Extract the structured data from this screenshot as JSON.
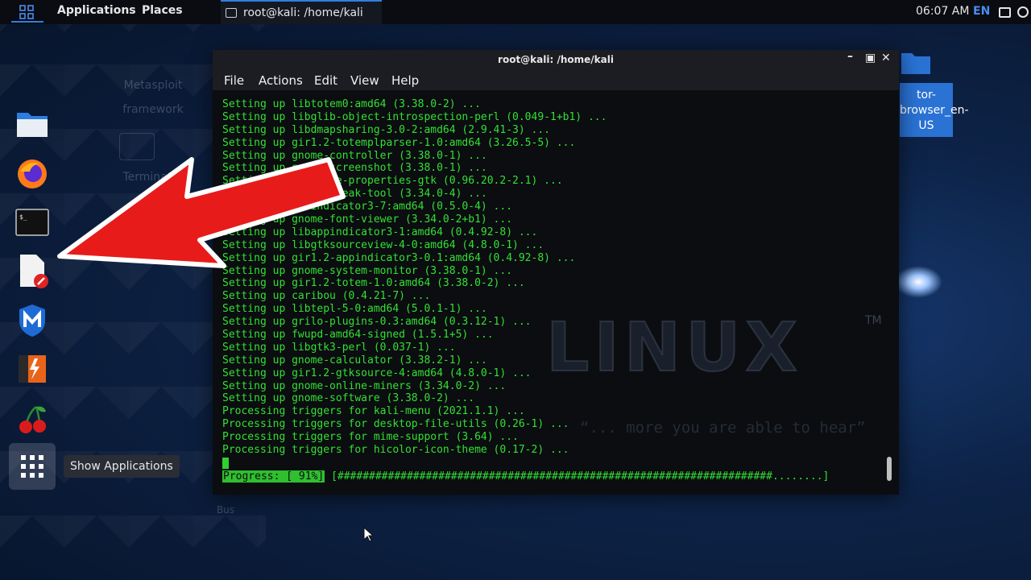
{
  "topbar": {
    "applications": "Applications",
    "places": "Places",
    "task_title": "root@kali: /home/kali",
    "clock": "06:07 AM",
    "lang": "EN"
  },
  "desktop": {
    "tor_label": "tor-browser_en-US",
    "tor_line1": "tor-",
    "tor_line2": "browser_en-",
    "tor_line3": "US",
    "faded_1": "Metasploit",
    "faded_2": "framework",
    "faded_3": "Terminator",
    "faded_4": "Bus"
  },
  "dock": {
    "items": [
      "files-icon",
      "firefox-icon",
      "terminal-icon",
      "text-editor-icon",
      "malwarebytes-icon",
      "burp-icon",
      "cherrytree-icon"
    ],
    "show_apps_tooltip": "Show Applications"
  },
  "terminal": {
    "title": "root@kali: /home/kali",
    "menu": [
      "File",
      "Actions",
      "Edit",
      "View",
      "Help"
    ],
    "lines": [
      "Setting up libtotem0:amd64 (3.38.0-2) ...",
      "Setting up libglib-object-introspection-perl (0.049-1+b1) ...",
      "Setting up libdmapsharing-3.0-2:amd64 (2.9.41-3) ...",
      "Setting up gir1.2-totemplparser-1.0:amd64 (3.26.5-5) ...",
      "Setting up gnome-controller (3.38.0-1) ...",
      "Setting up gnome-screenshot (3.38.0-1) ...",
      "Setting up software-properties-gtk (0.96.20.2-2.1) ...",
      "Setting up gnome-tweak-tool (3.34.0-4) ...",
      "Setting up libindicator3-7:amd64 (0.5.0-4) ...",
      "Setting up gnome-font-viewer (3.34.0-2+b1) ...",
      "Setting up libappindicator3-1:amd64 (0.4.92-8) ...",
      "Setting up libgtksourceview-4-0:amd64 (4.8.0-1) ...",
      "Setting up gir1.2-appindicator3-0.1:amd64 (0.4.92-8) ...",
      "Setting up gnome-system-monitor (3.38.0-1) ...",
      "Setting up gir1.2-totem-1.0:amd64 (3.38.0-2) ...",
      "Setting up caribou (0.4.21-7) ...",
      "Setting up libtepl-5-0:amd64 (5.0.1-1) ...",
      "Setting up grilo-plugins-0.3:amd64 (0.3.12-1) ...",
      "Setting up fwupd-amd64-signed (1.5.1+5) ...",
      "Setting up libgtk3-perl (0.037-1) ...",
      "Setting up gnome-calculator (3.38.2-1) ...",
      "Setting up gir1.2-gtksource-4:amd64 (4.8.0-1) ...",
      "Setting up gnome-online-miners (3.34.0-2) ...",
      "Setting up gnome-software (3.38.0-2) ...",
      "Processing triggers for kali-menu (2021.1.1) ...",
      "Processing triggers for desktop-file-utils (0.26-1) ...",
      "Processing triggers for mime-support (3.64) ...",
      "Processing triggers for hicolor-icon-theme (0.17-2) ..."
    ],
    "progress_label": "Progress: [ 91%]",
    "progress_bar": "[#####################################################################........]",
    "progress_percent": 91,
    "watermark": "LINUX",
    "watermark_tm": "TM",
    "quote": "“... more you are able to hear”"
  },
  "colors": {
    "terminal_text": "#33e033",
    "accent": "#2f7fe0",
    "arrow": "#e81b1b"
  }
}
